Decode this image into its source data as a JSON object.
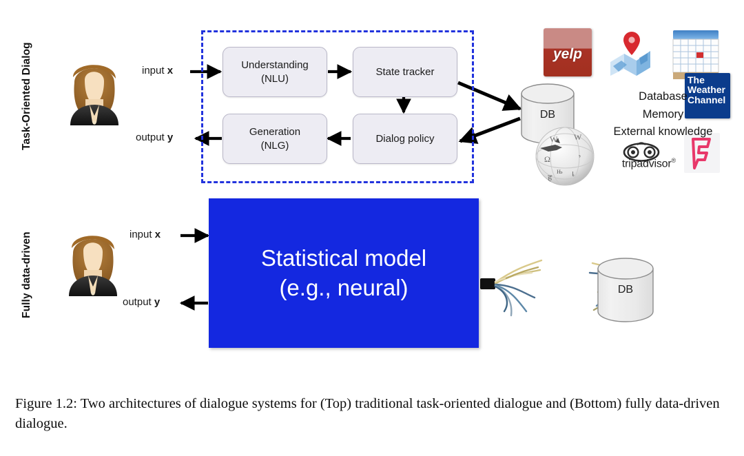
{
  "figure": {
    "caption": "Figure 1.2: Two architectures of dialogue systems for (Top) traditional task-oriented dialogue and (Bottom) fully data-driven dialogue."
  },
  "top_row": {
    "side_label": "Task-Oriented Dialog",
    "avatar_name": "user-avatar",
    "input_label": "input ",
    "input_var": "x",
    "output_label": "output ",
    "output_var": "y",
    "boxes": [
      {
        "id": "nlu",
        "line1": "Understanding",
        "line2": "(NLU)"
      },
      {
        "id": "state-tracker",
        "line1": "State tracker",
        "line2": ""
      },
      {
        "id": "nlg",
        "line1": "Generation",
        "line2": "(NLG)"
      },
      {
        "id": "dialog-policy",
        "line1": "Dialog policy",
        "line2": ""
      }
    ],
    "db_label": "DB",
    "knowledge_lines": [
      "Database",
      "Memory",
      "External knowledge"
    ],
    "logos": [
      {
        "id": "yelp",
        "text": "yelp"
      },
      {
        "id": "google-maps",
        "text": ""
      },
      {
        "id": "calendar",
        "text": ""
      },
      {
        "id": "weather-channel",
        "line1": "The",
        "line2": "Weather",
        "line3": "Channel"
      },
      {
        "id": "wikipedia",
        "text": ""
      },
      {
        "id": "tripadvisor",
        "text": "tripadvisor",
        "mark": "®"
      },
      {
        "id": "foursquare",
        "text": ""
      }
    ]
  },
  "bottom_row": {
    "side_label": "Fully data-driven",
    "avatar_name": "user-avatar",
    "input_label": "input ",
    "input_var": "x",
    "output_label": "output ",
    "output_var": "y",
    "model_line1": "Statistical model",
    "model_line2": "(e.g., neural)",
    "db_label": "DB"
  },
  "colors": {
    "model_blue": "#1428e0",
    "dashed_border": "#2233dd",
    "box_fill": "#edecf3",
    "box_border": "#b9b7c8",
    "arrow": "#000000",
    "yelp_red": "#a93226",
    "weather_blue": "#0b3c8c",
    "foursquare_pink": "#e8386a"
  }
}
